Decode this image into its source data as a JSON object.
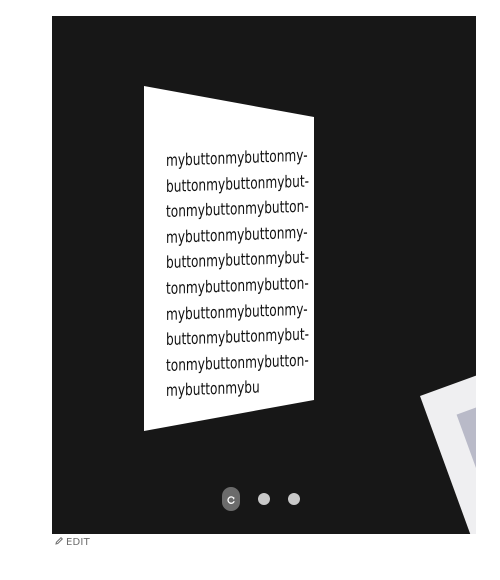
{
  "stage": {
    "card_text_lines": [
      "mybuttonmybuttonmy-",
      "buttonmybuttonmybut-",
      "tonmybuttonmybutton-",
      "mybuttonmybuttonmy-",
      "buttonmybuttonmybut-",
      "tonmybuttonmybutton-",
      "mybuttonmybuttonmy-",
      "buttonmybuttonmybut-",
      "tonmybuttonmybutton-",
      "mybuttonmybu"
    ]
  },
  "pagination": {
    "dots": [
      {
        "state": "active",
        "icon": "refresh-icon"
      },
      {
        "state": "inactive"
      },
      {
        "state": "inactive"
      }
    ]
  },
  "footer": {
    "edit_label": "EDIT",
    "edit_icon": "pencil-icon"
  },
  "colors": {
    "stage_bg": "#171717",
    "card_bg": "#ffffff",
    "dot_active": "#6b6b6b",
    "dot_inactive": "#c9c9c9"
  }
}
